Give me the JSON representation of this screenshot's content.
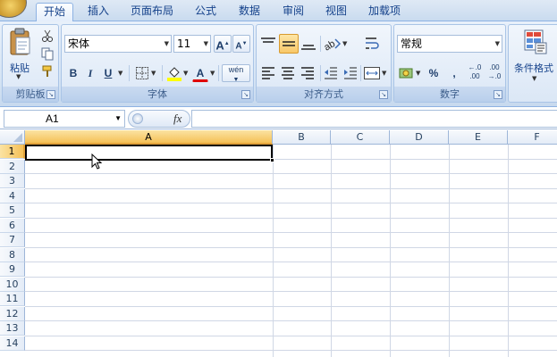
{
  "tabs": [
    {
      "label": "开始",
      "active": true
    },
    {
      "label": "插入"
    },
    {
      "label": "页面布局"
    },
    {
      "label": "公式"
    },
    {
      "label": "数据"
    },
    {
      "label": "审阅"
    },
    {
      "label": "视图"
    },
    {
      "label": "加载项"
    }
  ],
  "clipboard": {
    "paste_label": "粘贴",
    "group_label": "剪贴板"
  },
  "font": {
    "name": "宋体",
    "size": "11",
    "bold": "B",
    "italic": "I",
    "underline": "U",
    "grow": "A",
    "shrink": "A",
    "font_color": "A",
    "phonetic": "wén",
    "group_label": "字体"
  },
  "alignment": {
    "group_label": "对齐方式"
  },
  "number": {
    "format": "常规",
    "percent": "%",
    "comma": ",",
    "inc_decimal": "←.0\n.00",
    "dec_decimal": ".00\n→.0",
    "group_label": "数字"
  },
  "styles": {
    "conditional_label": "条件格式"
  },
  "formula_bar": {
    "name_box": "A1",
    "fx": "fx",
    "content": ""
  },
  "sheet": {
    "columns": [
      "A",
      "B",
      "C",
      "D",
      "E",
      "F"
    ],
    "rows": [
      "1",
      "2",
      "3",
      "4",
      "5",
      "6",
      "7",
      "8",
      "9",
      "10",
      "11",
      "12",
      "13",
      "14"
    ],
    "active_cell": "A1"
  },
  "colors": {
    "accent": "#f5c056",
    "ribbon": "#dbe7f6",
    "header_text": "#15428b"
  }
}
